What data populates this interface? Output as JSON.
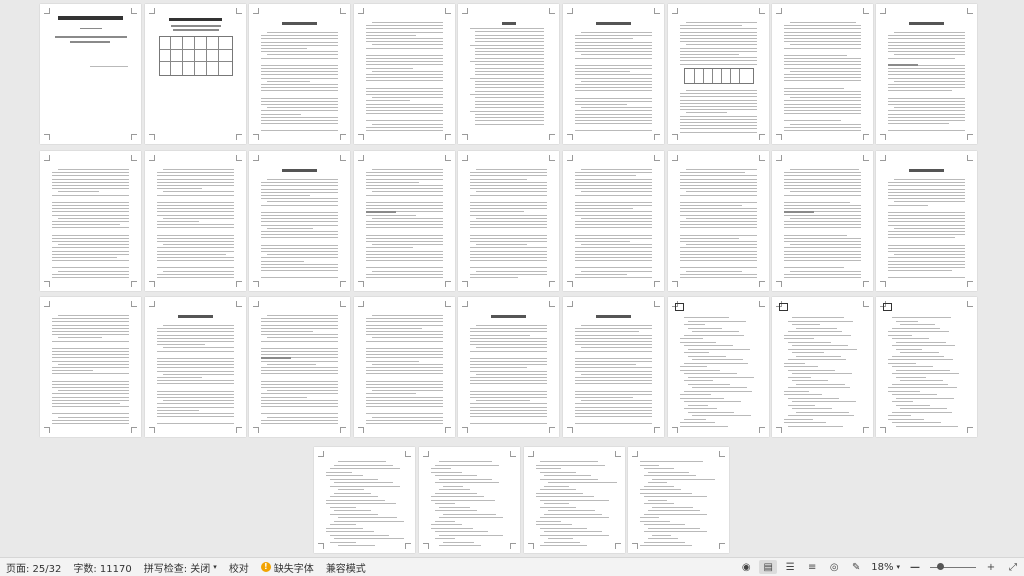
{
  "document": {
    "cover_title": "电子科技大学成都学院",
    "cover_subtitle": "计算机学院",
    "cover_topic": "《C/S、B/S结构的TV企业设计（二期）》",
    "form_title_1": "电子科技大学成都学院",
    "form_title_2": "工程项目设计实训评分表",
    "page_count": 32
  },
  "statusbar": {
    "page": "页面: 25/32",
    "words": "字数: 11170",
    "spellcheck": "拼写检查: 关闭",
    "proofread": "校对",
    "missing_font": "缺失字体",
    "compat_mode": "兼容模式",
    "zoom": "18%",
    "zoom_fraction": 0.18,
    "icons": [
      "eye-icon",
      "page-view-icon",
      "list-icon",
      "outline-icon",
      "web-view-icon",
      "edit-icon",
      "minus-icon",
      "plus-icon",
      "fit-icon"
    ]
  }
}
